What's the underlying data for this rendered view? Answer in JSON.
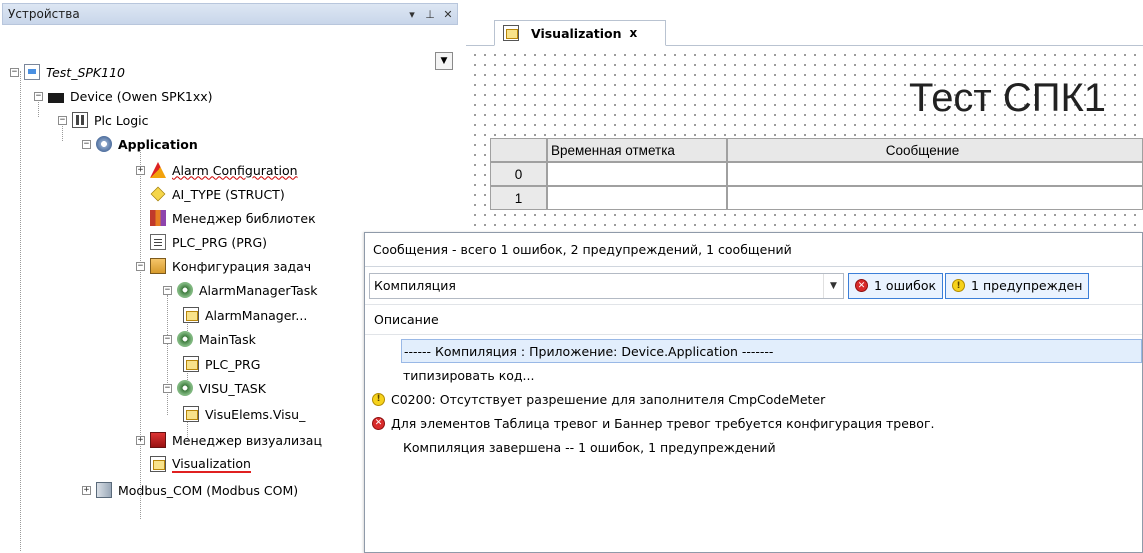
{
  "devices_panel": {
    "title": "Устройства",
    "buttons": {
      "dropdown": "▾",
      "pin": "⊥",
      "close": "✕"
    },
    "tree": [
      {
        "label": "Test_SPK110",
        "icon": "project-icon"
      },
      {
        "label": "Device (Owen SPK1xx)",
        "icon": "device-icon"
      },
      {
        "label": "Plc Logic",
        "icon": "plc-logic-icon"
      },
      {
        "label": "Application",
        "icon": "application-gear-icon"
      },
      {
        "label": "Alarm Configuration",
        "icon": "alarm-configuration-icon"
      },
      {
        "label": "AI_TYPE (STRUCT)",
        "icon": "struct-icon"
      },
      {
        "label": "Менеджер библиотек",
        "icon": "library-manager-icon"
      },
      {
        "label": "PLC_PRG (PRG)",
        "icon": "program-icon"
      },
      {
        "label": "Конфигурация задач",
        "icon": "task-configuration-icon"
      },
      {
        "label": "AlarmManagerTask",
        "icon": "task-icon"
      },
      {
        "label": "AlarmManager...",
        "icon": "visualization-icon"
      },
      {
        "label": "MainTask",
        "icon": "task-icon"
      },
      {
        "label": "PLC_PRG",
        "icon": "visualization-icon"
      },
      {
        "label": "VISU_TASK",
        "icon": "task-icon"
      },
      {
        "label": "VisuElems.Visu_",
        "icon": "visualization-icon"
      },
      {
        "label": "Менеджер визуализац",
        "icon": "visualization-manager-icon"
      },
      {
        "label": "Visualization",
        "icon": "visualization-icon"
      },
      {
        "label": "Modbus_COM (Modbus COM)",
        "icon": "modbus-icon"
      }
    ]
  },
  "editor": {
    "tab": {
      "label": "Visualization",
      "close": "x"
    },
    "canvas": {
      "title": "Тест СПК1",
      "table": {
        "headers": [
          "",
          "Временная отметка",
          "Сообщение"
        ],
        "rows": [
          "0",
          "1"
        ]
      }
    }
  },
  "messages": {
    "title": "Сообщения - всего 1 ошибок, 2 предупреждений, 1 сообщений",
    "source": "Компиляция",
    "filters": {
      "errors": "1 ошибок",
      "warnings": "1 предупрежден"
    },
    "column": "Описание",
    "rows": [
      {
        "text": "------ Компиляция : Приложение: Device.Application -------",
        "type": "header"
      },
      {
        "text": "типизировать код...",
        "type": "info"
      },
      {
        "text": "C0200:  Отсутствует разрешение для заполнителя CmpCodeMeter",
        "type": "warning"
      },
      {
        "text": "Для элементов Таблица тревог и Баннер тревог требуется конфигурация тревог.",
        "type": "error"
      },
      {
        "text": "Компиляция завершена -- 1 ошибок, 1 предупреждений",
        "type": "info"
      }
    ]
  },
  "colors": {
    "selection": "#e2eefc",
    "error": "#d82b2b",
    "warning": "#f6d21c",
    "accent": "#3c7fd8"
  }
}
